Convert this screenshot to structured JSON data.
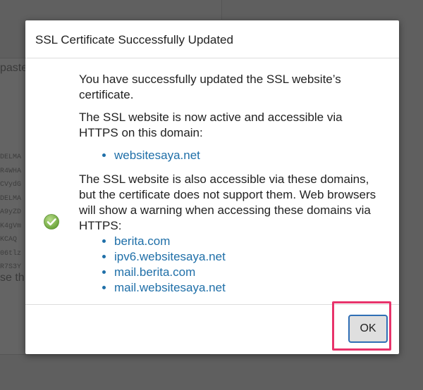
{
  "background": {
    "paste_label": "paste",
    "code_lines": [
      "DELMA",
      "R4WHA",
      "CVydG",
      "DELMA",
      "A9yZD",
      "K4gVm",
      "KCAQ",
      "06tlz",
      "R7S3Y"
    ],
    "bottom_text": "se th"
  },
  "dialog": {
    "title": "SSL Certificate Successfully Updated",
    "paragraph1": "You have successfully updated the SSL website’s certificate.",
    "paragraph2": "The SSL website is now active and accessible via HTTPS on this domain:",
    "primary_domains": [
      "websitesaya.net"
    ],
    "paragraph3": "The SSL website is also accessible via these domains, but the certificate does not support them. Web browsers will show a warning when accessing these domains via HTTPS:",
    "other_domains": [
      "berita.com",
      "ipv6.websitesaya.net",
      "mail.berita.com",
      "mail.websitesaya.net"
    ],
    "ok_label": "OK"
  },
  "colors": {
    "link": "#1f6fa8",
    "highlight": "#e8336b",
    "success_icon": "#7cb342"
  }
}
